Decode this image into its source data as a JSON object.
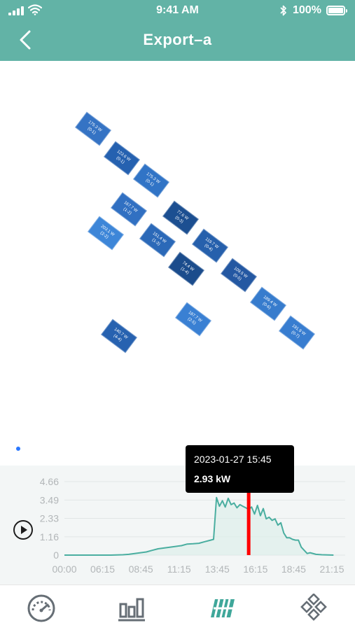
{
  "status_bar": {
    "time": "9:41 AM",
    "battery": "100%",
    "bluetooth_icon": "bluetooth-icon"
  },
  "header": {
    "title": "Export–a",
    "back_icon": "chevron-left-icon"
  },
  "colors": {
    "header": "#62b3a6",
    "line": "#4aaea0",
    "marker": "#ff0000"
  },
  "panels": [
    {
      "power": "175.3 W",
      "id": "(0-1)",
      "color": "#3573c4"
    },
    {
      "power": "123.6 W",
      "id": "(0-1)",
      "color": "#2561b0"
    },
    {
      "power": "175.3 W",
      "id": "(0-1)",
      "color": "#3174c6"
    },
    {
      "power": "167.7 W",
      "id": "(1-2)",
      "color": "#3170c2"
    },
    {
      "power": "77.6 W",
      "id": "(0-3)",
      "color": "#1c4f91"
    },
    {
      "power": "203.1 W",
      "id": "(2-2)",
      "color": "#3d86d8"
    },
    {
      "power": "151.4 W",
      "id": "(1-3)",
      "color": "#2b69b8"
    },
    {
      "power": "119.7 W",
      "id": "(0-4)",
      "color": "#2660ac"
    },
    {
      "power": "74.4 W",
      "id": "(1-4)",
      "color": "#1b4c8c"
    },
    {
      "power": "109.5 W",
      "id": "(0-5)",
      "color": "#2458a2"
    },
    {
      "power": "189.4 W",
      "id": "(0-6)",
      "color": "#377ccd"
    },
    {
      "power": "187.7 W",
      "id": "(2-5)",
      "color": "#3a80d3"
    },
    {
      "power": "140.7 W",
      "id": "(4-4)",
      "color": "#2762b0"
    },
    {
      "power": "191.9 W",
      "id": "(0-7)",
      "color": "#387dd0"
    }
  ],
  "tooltip": {
    "time": "2023-01-27 15:45",
    "value": "2.93 kW"
  },
  "chart_data": {
    "type": "area",
    "y_ticks": [
      "4.66",
      "3.49",
      "2.33",
      "1.16",
      "0"
    ],
    "ylim": [
      0,
      4.66
    ],
    "x_ticks": [
      "00:00",
      "06:15",
      "08:45",
      "11:15",
      "13:45",
      "16:15",
      "18:45",
      "21:15"
    ],
    "x_hours": [
      0,
      0.5,
      4.0,
      5.0,
      5.5,
      6.0,
      6.5,
      7.0,
      7.5,
      8.0,
      8.5,
      9.0,
      9.5,
      10.0,
      10.5,
      11.0,
      11.5,
      12.0,
      12.5,
      12.75,
      13.0,
      13.25,
      13.5,
      13.75,
      14.0,
      14.25,
      14.5,
      14.75,
      15.0,
      15.25,
      15.5,
      15.75,
      16.0,
      16.25,
      16.5,
      16.75,
      17.0,
      17.25,
      17.5,
      17.75,
      18.0,
      18.25,
      18.5,
      18.75,
      19.0,
      19.25,
      19.5,
      19.75,
      20.0,
      20.25,
      20.5,
      20.75,
      21.0,
      21.5,
      22.0,
      23.0
    ],
    "values": [
      0,
      0,
      0,
      0.02,
      0.05,
      0.1,
      0.15,
      0.2,
      0.3,
      0.4,
      0.45,
      0.5,
      0.55,
      0.6,
      0.7,
      0.72,
      0.75,
      0.85,
      0.95,
      1.0,
      3.65,
      3.1,
      3.45,
      3.05,
      3.6,
      3.2,
      3.3,
      3.0,
      3.2,
      3.1,
      3.0,
      2.9,
      3.05,
      2.6,
      3.15,
      2.5,
      2.95,
      2.3,
      2.4,
      2.2,
      2.3,
      1.9,
      2.05,
      1.4,
      1.1,
      1.1,
      1.0,
      0.95,
      0.95,
      0.5,
      0.3,
      0.1,
      0.15,
      0.05,
      0.02,
      0
    ],
    "marker_hour": 15.75
  },
  "nav": [
    {
      "icon": "speedometer-icon",
      "active": false
    },
    {
      "icon": "bar-chart-icon",
      "active": false
    },
    {
      "icon": "panel-layout-icon",
      "active": true
    },
    {
      "icon": "grid-diamond-icon",
      "active": false
    }
  ]
}
